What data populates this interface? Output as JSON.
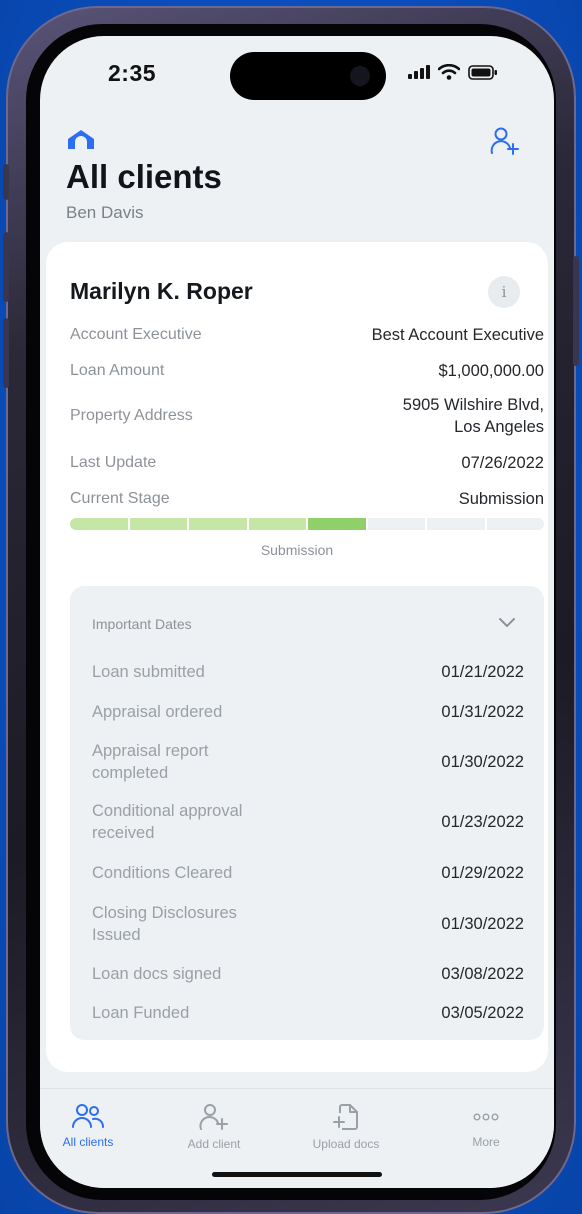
{
  "status_bar": {
    "time": "2:35"
  },
  "header": {
    "title": "All clients",
    "subtitle": "Ben Davis"
  },
  "client": {
    "name": "Marilyn K. Roper",
    "details": [
      {
        "label": "Account Executive",
        "value": "Best Account Executive"
      },
      {
        "label": "Loan Amount",
        "value": "$1,000,000.00"
      },
      {
        "label": "Property Address",
        "value_line1": "5905 Wilshire Blvd,",
        "value_line2": "Los Angeles"
      },
      {
        "label": "Last Update",
        "value": "07/26/2022"
      },
      {
        "label": "Current Stage",
        "value": "Submission"
      }
    ],
    "progress": {
      "total_stages": 8,
      "completed_stages": 4,
      "current_stage_index": 5,
      "caption": "Submission"
    }
  },
  "important_dates": {
    "header": "Important Dates",
    "rows": [
      {
        "label": "Loan submitted",
        "value": "01/21/2022"
      },
      {
        "label": "Appraisal ordered",
        "value": "01/31/2022"
      },
      {
        "label": "Appraisal report completed",
        "value": "01/30/2022"
      },
      {
        "label": "Conditional approval received",
        "value": "01/23/2022"
      },
      {
        "label": "Conditions Cleared",
        "value": "01/29/2022"
      },
      {
        "label": "Closing Disclosures Issued",
        "value": "01/30/2022"
      },
      {
        "label": "Loan docs signed",
        "value": "03/08/2022"
      },
      {
        "label": "Loan Funded",
        "value": "03/05/2022"
      }
    ]
  },
  "tabs": [
    {
      "label": "All clients",
      "icon": "users-icon",
      "active": true
    },
    {
      "label": "Add client",
      "icon": "add-user-icon",
      "active": false
    },
    {
      "label": "Upload docs",
      "icon": "upload-doc-icon",
      "active": false
    },
    {
      "label": "More",
      "icon": "more-icon",
      "active": false
    }
  ],
  "colors": {
    "accent": "#2b6ef2",
    "progress_done": "#c6e6a8",
    "progress_current": "#8fd06a",
    "progress_todo": "#eef1f3"
  }
}
